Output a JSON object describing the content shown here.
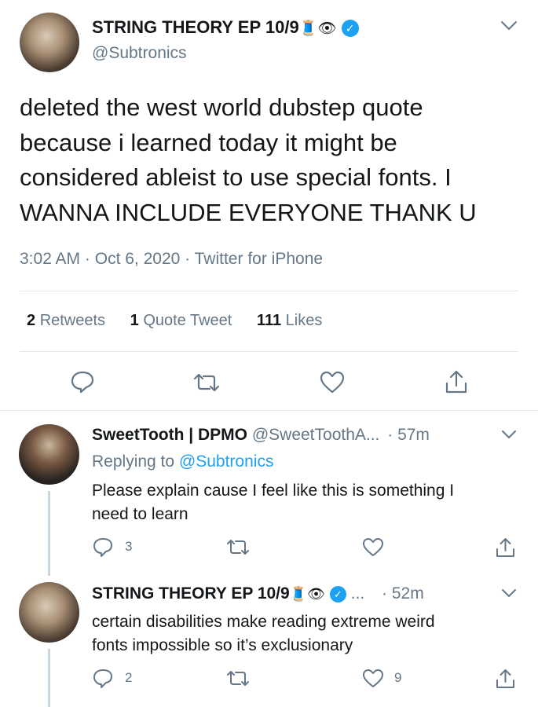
{
  "main_tweet": {
    "display_name": "STRING THEORY EP 10/9",
    "emoji": "🧵👁",
    "handle": "@Subtronics",
    "text_lines": [
      "deleted the west world dubstep quote",
      "because i learned today it might be",
      "considered ableist to use special fonts. I",
      "WANNA INCLUDE EVERYONE THANK U"
    ],
    "time": "3:02 AM",
    "date": "Oct 6, 2020",
    "source": "Twitter for iPhone",
    "sep": "·",
    "stats": {
      "retweets_count": "2",
      "retweets_label": "Retweets",
      "quotes_count": "1",
      "quotes_label": "Quote Tweet",
      "likes_count": "111",
      "likes_label": "Likes"
    }
  },
  "replies": [
    {
      "display_name": "SweetTooth | DPMO",
      "handle": "@SweetToothA...",
      "time": "· 57m",
      "replying_prefix": "Replying to",
      "replying_to": "@Subtronics",
      "text_lines": [
        "Please explain cause I feel like this is something I",
        "need to learn"
      ],
      "reply_count": "3",
      "retweet_count": "",
      "like_count": ""
    },
    {
      "display_name": "STRING THEORY EP 10/9",
      "emoji": "🧵👁",
      "ellipsis": "...",
      "time": "· 52m",
      "text_lines": [
        "certain disabilities make reading extreme weird",
        "fonts impossible so it’s exclusionary"
      ],
      "reply_count": "2",
      "retweet_count": "",
      "like_count": "9"
    }
  ],
  "colors": {
    "accent": "#1da1f2",
    "muted": "#657786",
    "text": "#14171a",
    "divider": "#e1e8ed"
  }
}
